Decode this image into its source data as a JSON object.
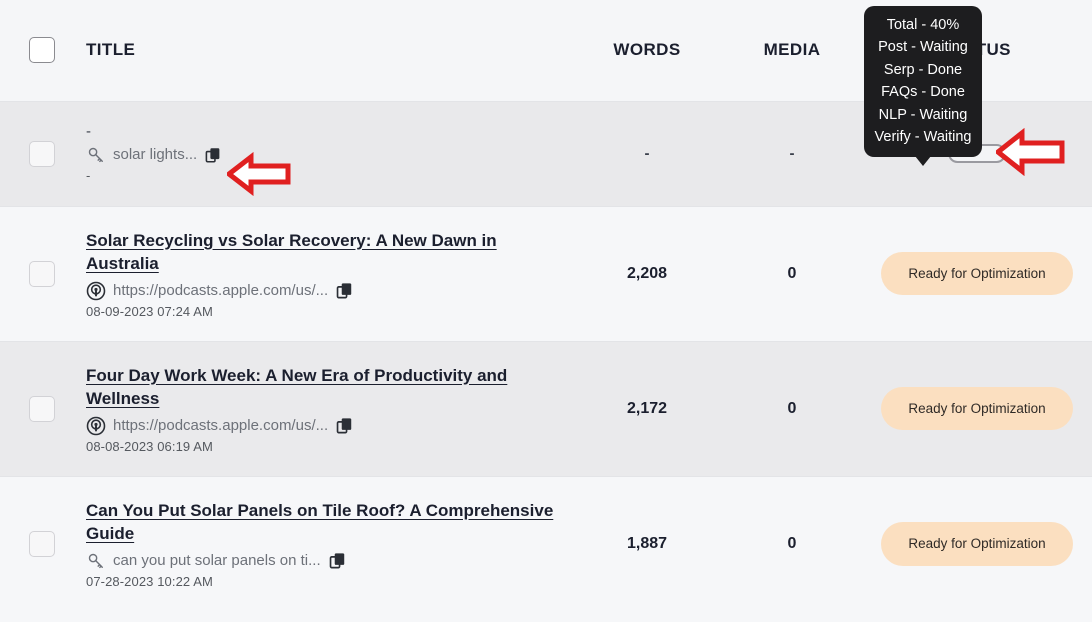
{
  "table": {
    "columns": {
      "select_all": "",
      "title": "TITLE",
      "words": "WORDS",
      "media": "MEDIA",
      "status": "STATUS"
    },
    "rows": [
      {
        "title": "-",
        "sub_icon": "key-icon",
        "sub_text": "solar lights...",
        "date": "-",
        "words": "-",
        "media": "-",
        "status_type": "progress",
        "status_progress": 40
      },
      {
        "title": "Solar Recycling vs Solar Recovery: A New Dawn in Australia",
        "sub_icon": "podcast-icon",
        "sub_text": "https://podcasts.apple.com/us/...",
        "date": "08-09-2023 07:24 AM",
        "words": "2,208",
        "media": "0",
        "status_type": "badge",
        "status_label": "Ready for Optimization"
      },
      {
        "title": "Four Day Work Week: A New Era of Productivity and Wellness",
        "sub_icon": "podcast-icon",
        "sub_text": "https://podcasts.apple.com/us/...",
        "date": "08-08-2023 06:19 AM",
        "words": "2,172",
        "media": "0",
        "status_type": "badge",
        "status_label": "Ready for Optimization"
      },
      {
        "title": "Can You Put Solar Panels on Tile Roof? A Comprehensive Guide",
        "sub_icon": "key-icon",
        "sub_text": "can you put solar panels on ti...",
        "date": "07-28-2023 10:22 AM",
        "words": "1,887",
        "media": "0",
        "status_type": "badge",
        "status_label": "Ready for Optimization"
      }
    ]
  },
  "tooltip": {
    "lines": [
      "Total - 40%",
      "Post - Waiting",
      "Serp - Done",
      "FAQs - Done",
      "NLP - Waiting",
      "Verify - Waiting"
    ]
  },
  "annotations": {
    "arrow_keyword": "left-arrow-annotation",
    "arrow_status": "left-arrow-annotation"
  },
  "colors": {
    "accent_blue": "#1a73f0",
    "badge_bg": "#fbdfc0",
    "tooltip_bg": "#1d1d1f",
    "annotation_red": "#e02020",
    "text_dark": "#1b1f2e"
  }
}
